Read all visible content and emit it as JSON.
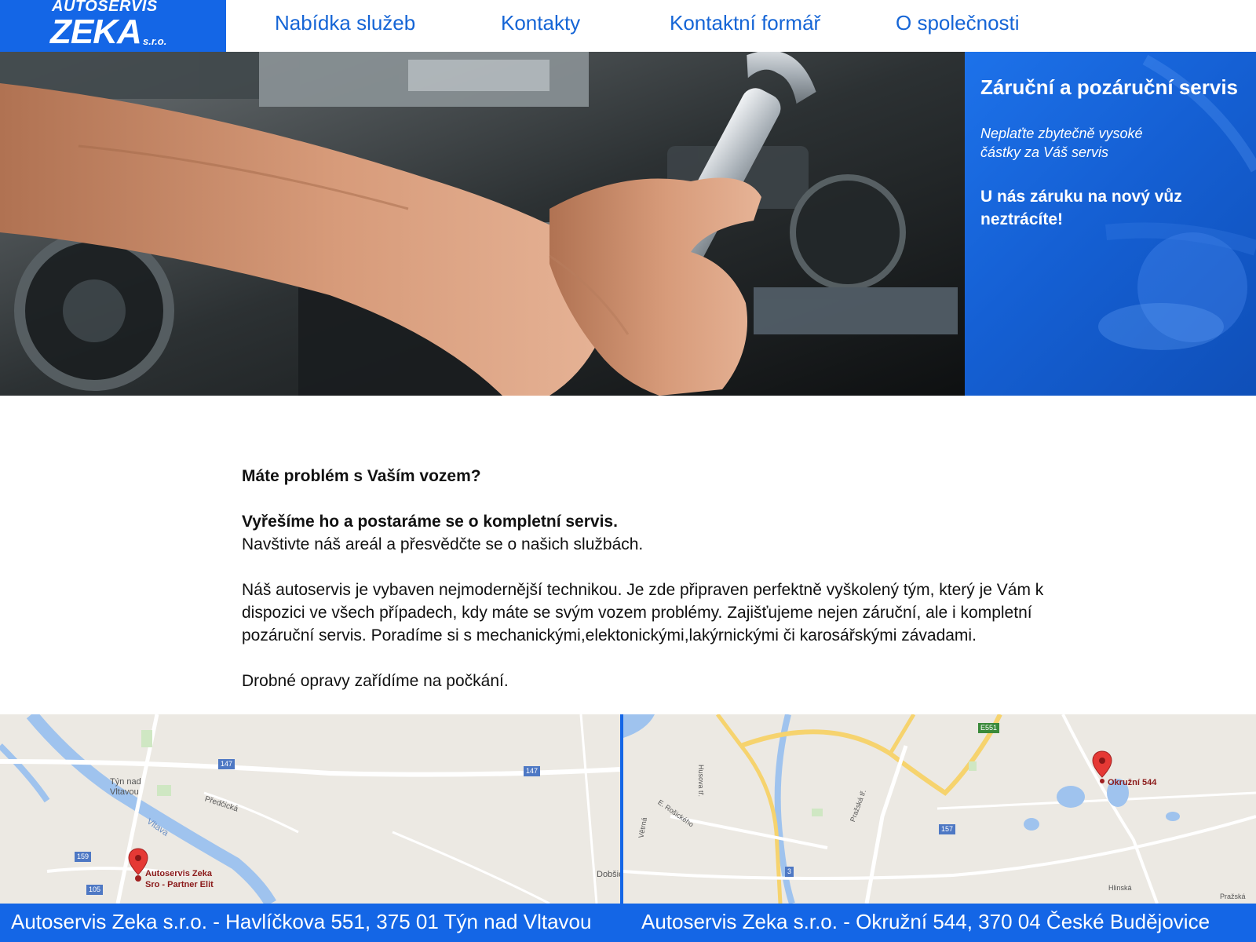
{
  "logo": {
    "top_line": "AUTOSERVIS",
    "main": "ZEKA",
    "suffix": "s.r.o."
  },
  "nav": {
    "items": [
      {
        "label": "Nabídka služeb"
      },
      {
        "label": "Kontakty"
      },
      {
        "label": "Kontaktní formář"
      },
      {
        "label": "O společnosti"
      }
    ]
  },
  "promo": {
    "title": "Záruční a pozáruční servis",
    "subtitle": "Neplaťte zbytečně vysoké částky za Váš servis",
    "highlight": "U nás záruku na nový vůz neztrácíte!"
  },
  "content": {
    "question": "Máte problém s Vaším vozem?",
    "answer": "Vyřešíme ho a postaráme se o kompletní servis.",
    "visit": "Navštivte náš areál a přesvědčte se o našich službách.",
    "description": "Náš autoservis je vybaven nejmodernější technikou. Je zde připraven perfektně vyškolený tým, který je Vám k dispozici ve všech případech, kdy máte se svým vozem problémy. Zajišťujeme nejen záruční, ale i kompletní pozáruční servis. Poradíme si s mechanickými,elektonickými,lakýrnickými či karosářskými závadami.",
    "small_repairs": "Drobné opravy zařídíme na počkání."
  },
  "maps": {
    "left": {
      "marker_label_line1": "Autoservis Zeka",
      "marker_label_line2": "Sro - Partner Elit",
      "town_line1": "Týn nad",
      "town_line2": "Vltavou",
      "river": "Vltava",
      "street": "Předčická",
      "place_right": "Dobšic",
      "roads": [
        "147",
        "147",
        "159",
        "105"
      ]
    },
    "right": {
      "marker_label": "Okružní 544",
      "streets": [
        "Husova tř.",
        "E. Rošického",
        "Pražská tř.",
        "Větrná",
        "Hlinská",
        "Pražská"
      ],
      "roads": [
        "E551",
        "157",
        "3"
      ]
    }
  },
  "footer": {
    "address_left": "Autoservis Zeka s.r.o. - Havlíčkova 551, 375 01 Týn nad Vltavou",
    "address_right": "Autoservis Zeka s.r.o. - Okružní 544, 370 04 České Budějovice"
  },
  "colors": {
    "brand_blue": "#1466e6",
    "nav_text": "#1565d6",
    "map_marker": "#e53935"
  }
}
